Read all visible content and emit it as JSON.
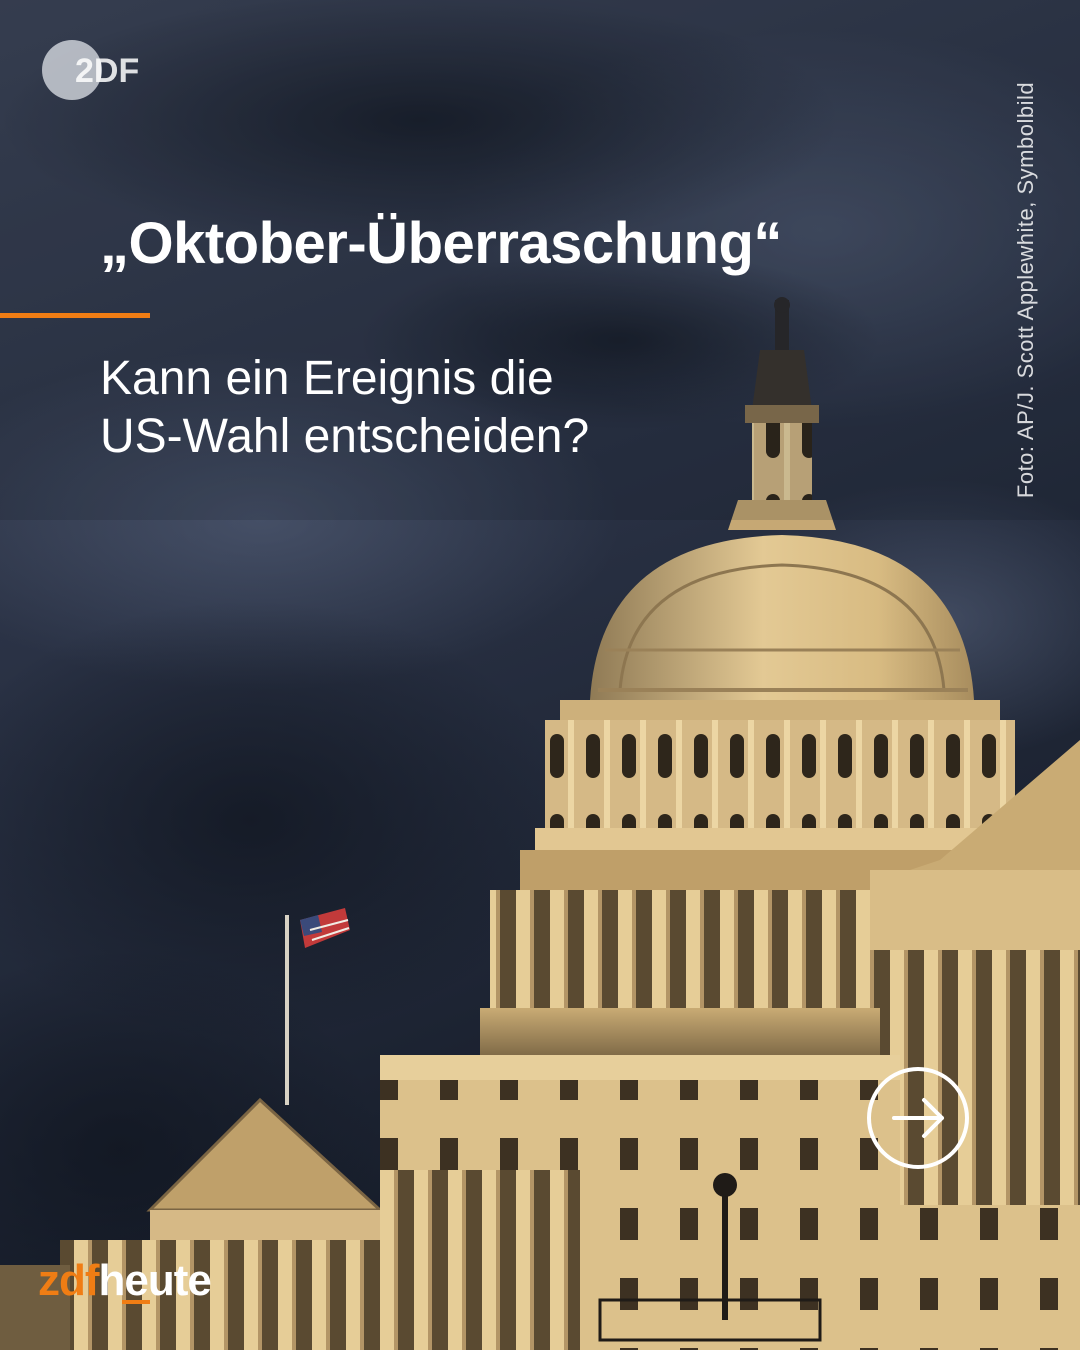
{
  "header": {
    "headline": "„Oktober-Überraschung“",
    "subline_line1": "Kann ein Ereignis die",
    "subline_line2": "US-Wahl entscheiden?"
  },
  "logo": {
    "text": "2DF"
  },
  "photo_credit": "Foto: AP/J. Scott Applewhite, Symbolbild",
  "brand": {
    "part1": "zdf",
    "part2": "heute"
  },
  "next_button": {
    "icon": "arrow-right-circle-icon"
  },
  "colors": {
    "accent": "#f07d14",
    "text": "#ffffff",
    "sky": "#2f3a4e",
    "stone": "#d9c08c"
  }
}
